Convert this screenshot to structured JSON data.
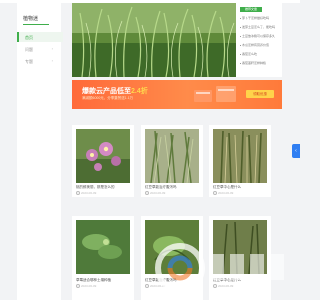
{
  "brand": {
    "logo_text": "植物迷"
  },
  "nav": [
    {
      "label": "首页",
      "active": true
    },
    {
      "label": "问题",
      "active": false
    },
    {
      "label": "专题",
      "active": false
    }
  ],
  "side_list": {
    "tab": "推荐文章",
    "items": [
      "萝卜干怎样做好吃吗",
      "发芽土豆怎么了，能吃吗",
      "土豆放冰箱可以保存多久",
      "木瓜怎样有营养价值",
      "番茄怎么吃",
      "番茄茎秆怎样种植"
    ]
  },
  "banner": {
    "title_prefix": "爆款云产品低至",
    "title_highlight": "2.4折",
    "subtitle": "满减额6000元，分享集赞送1.1万",
    "button": "领取优惠"
  },
  "cards": [
    {
      "title": "桃的鲜美丽，那是怎么的",
      "meta": "2023-06-09"
    },
    {
      "title": "红豆草能治疗腹泻吗",
      "meta": "2023-06-09"
    },
    {
      "title": "红豆草中心是什么",
      "meta": "2023-06-09"
    }
  ],
  "cards_row2": [
    {
      "title": "草莓适合哪种土壤种植",
      "meta": "2023-06-09"
    },
    {
      "title": "红豆草能治疗腹泻吗",
      "meta": "2023-06-09"
    },
    {
      "title": "红豆草中心是什么",
      "meta": "2023-06-09"
    }
  ],
  "colors": {
    "accent": "#3fae4b",
    "banner": "#ff6a3a",
    "float": "#2f7ef2"
  },
  "icons": {
    "chevron": "chevron-right-icon",
    "clock": "clock-icon",
    "float": "chevron-left-icon"
  }
}
